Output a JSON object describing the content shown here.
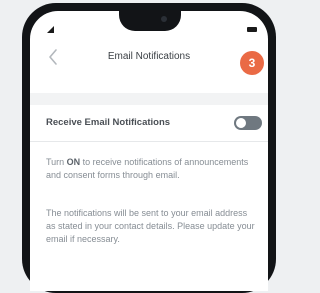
{
  "header": {
    "title": "Email Notifications",
    "badge_count": "3"
  },
  "setting": {
    "label": "Receive Email Notifications",
    "enabled": false
  },
  "info": {
    "p1_before": "Turn ",
    "p1_bold": "ON",
    "p1_after": " to receive notifications of announcements and consent forms through email.",
    "p2": "The notifications will be sent to your email address as stated in your contact details. Please update your email if necessary."
  },
  "colors": {
    "badge": "#ea6a45",
    "toggle_off": "#6f7880"
  },
  "icons": {
    "back": "chevron-left-icon",
    "signal": "signal-icon",
    "battery": "battery-icon"
  }
}
